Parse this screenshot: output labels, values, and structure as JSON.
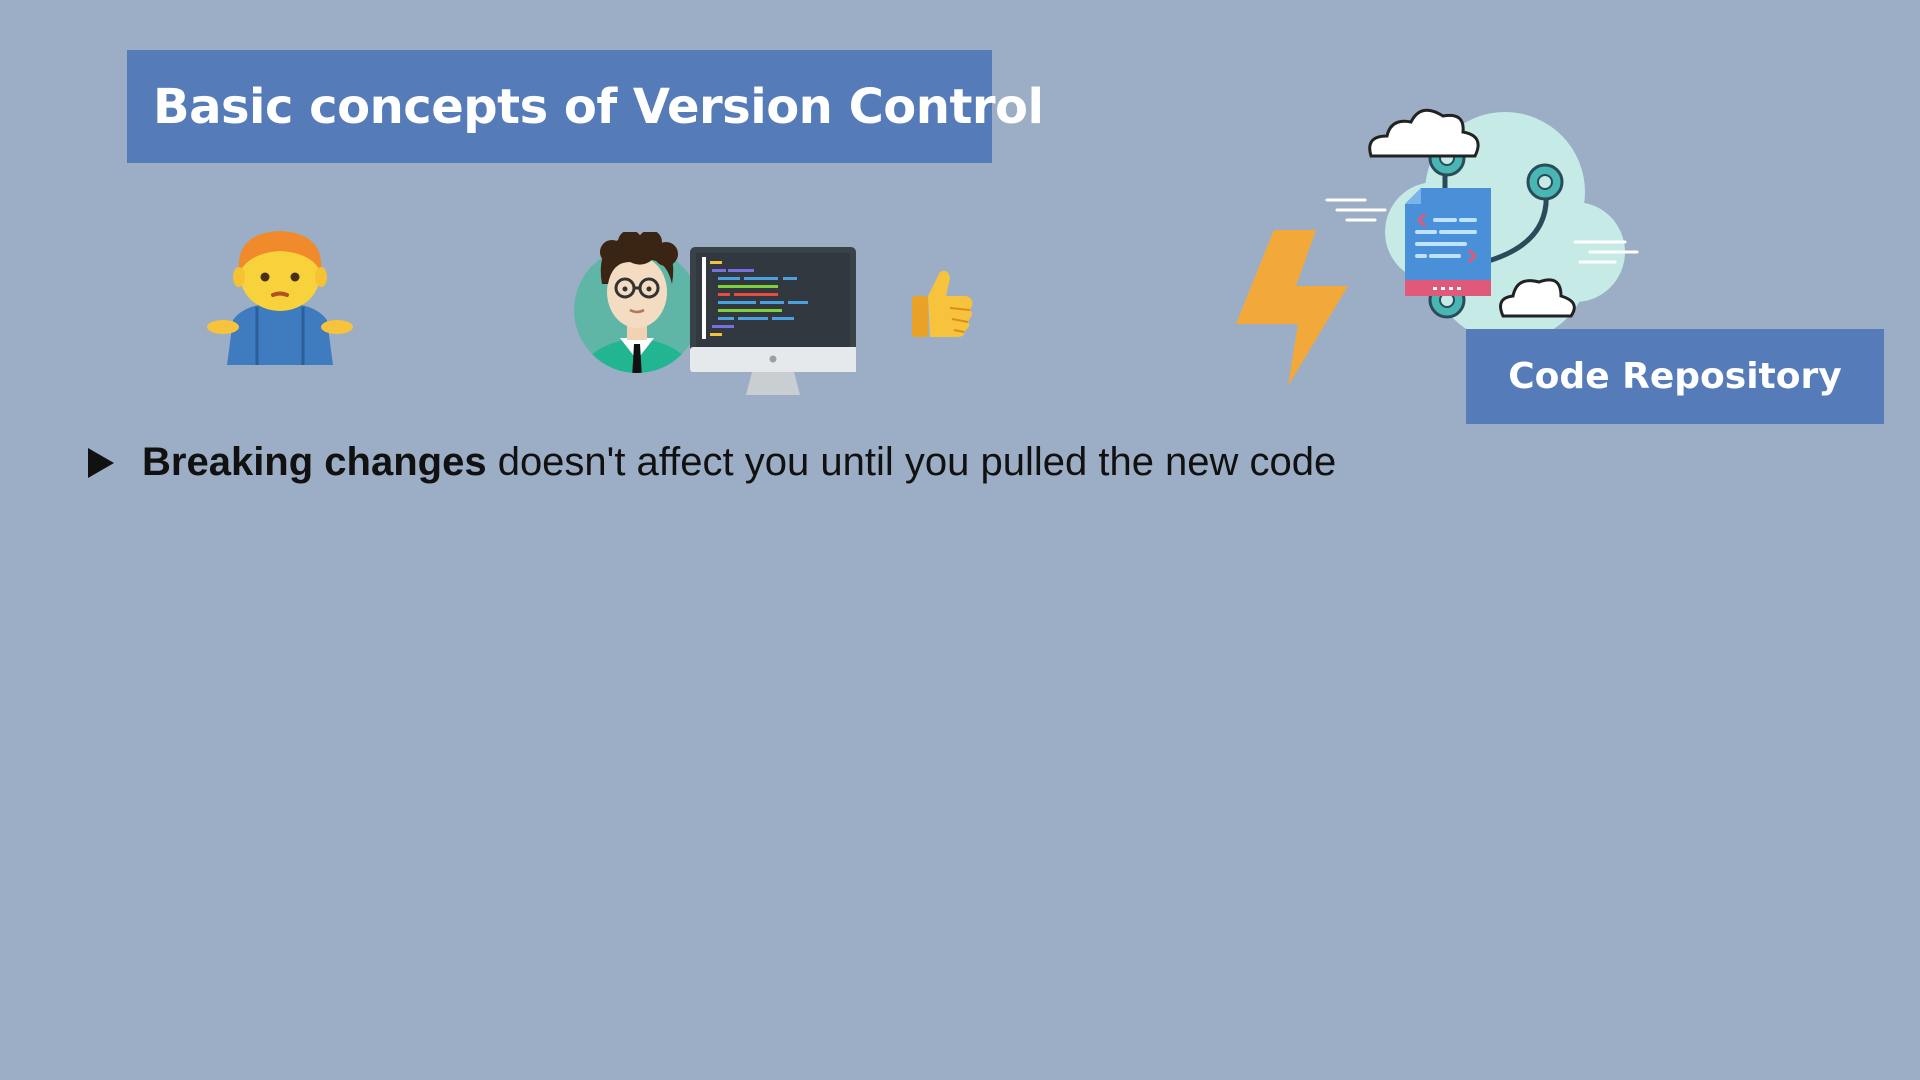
{
  "slide": {
    "title": "Basic concepts of Version Control",
    "repository_label": "Code Repository",
    "bullet": {
      "bold": "Breaking changes",
      "rest": " doesn't affect you until you pulled the new code"
    }
  },
  "illustrations": [
    "shrugging-person-icon",
    "developer-icon",
    "computer-monitor-icon",
    "thumbs-up-icon",
    "lightning-bolt-icon",
    "cloud-repository-icon"
  ],
  "colors": {
    "background": "#9caec5",
    "title_box": "#557cb8",
    "title_text": "#ffffff",
    "body_text": "#111111",
    "lightning": "#f3a93a"
  }
}
